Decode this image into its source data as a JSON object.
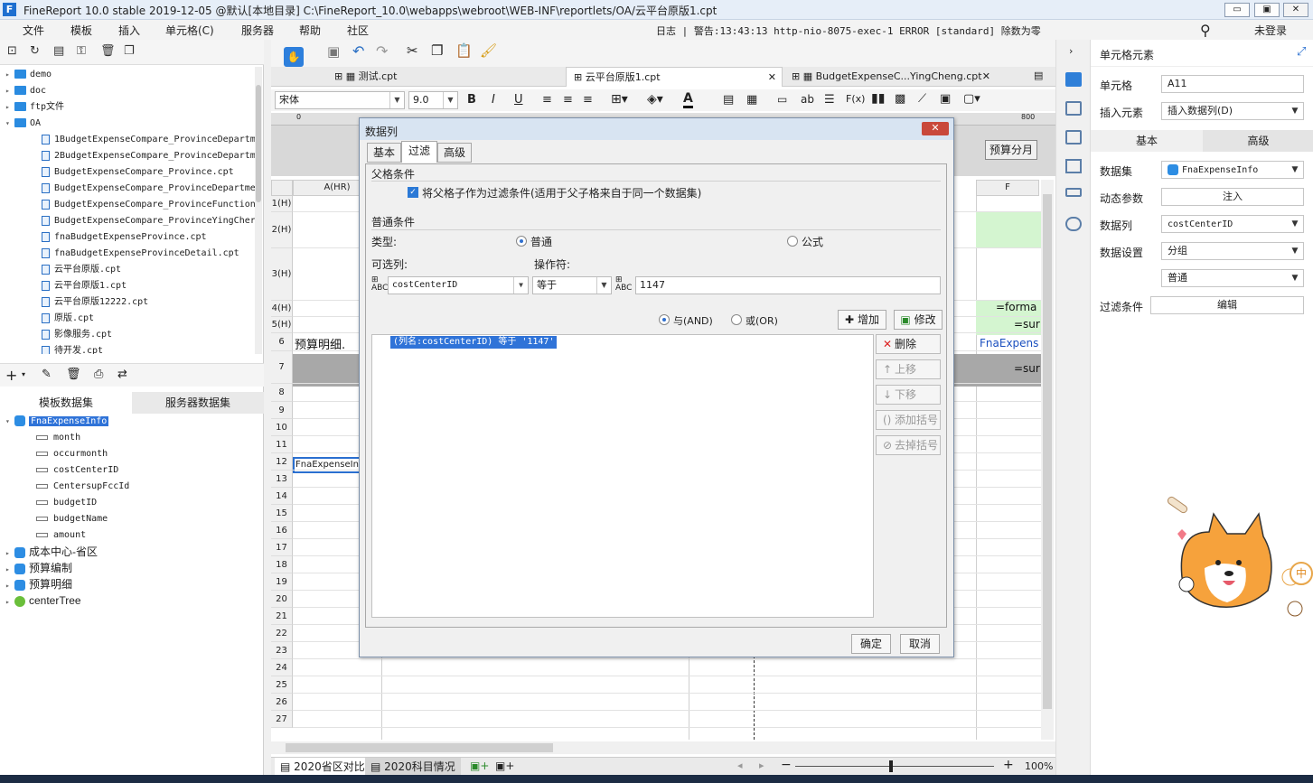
{
  "window": {
    "title": "FineReport 10.0 stable 2019-12-05 @默认[本地目录]    C:\\FineReport_10.0\\webapps\\webroot\\WEB-INF\\reportlets/OA/云平台原版1.cpt",
    "logo": "F",
    "min": "▭",
    "max": "▣",
    "close": "✕"
  },
  "menu": {
    "items": [
      "文件",
      "模板",
      "插入",
      "单元格(C)",
      "服务器",
      "帮助",
      "社区"
    ],
    "status": "日志 | 警告:13:43:13 http-nio-8075-exec-1 ERROR [standard] 除数为零",
    "login": "未登录",
    "search": "⚲"
  },
  "tree": {
    "items": [
      {
        "label": "demo",
        "kind": "folder",
        "open": false
      },
      {
        "label": "doc",
        "kind": "folder",
        "open": false
      },
      {
        "label": "ftp文件",
        "kind": "folder",
        "open": false
      },
      {
        "label": "OA",
        "kind": "folder",
        "open": true
      },
      {
        "label": "1BudgetExpenseCompare_ProvinceDepartm",
        "kind": "file"
      },
      {
        "label": "2BudgetExpenseCompare_ProvinceDepartm",
        "kind": "file"
      },
      {
        "label": "BudgetExpenseCompare_Province.cpt",
        "kind": "file"
      },
      {
        "label": "BudgetExpenseCompare_ProvinceDepartme",
        "kind": "file"
      },
      {
        "label": "BudgetExpenseCompare_ProvinceFunction",
        "kind": "file"
      },
      {
        "label": "BudgetExpenseCompare_ProvinceYingCher",
        "kind": "file"
      },
      {
        "label": "fnaBudgetExpenseProvince.cpt",
        "kind": "file"
      },
      {
        "label": "fnaBudgetExpenseProvinceDetail.cpt",
        "kind": "file"
      },
      {
        "label": "云平台原版.cpt",
        "kind": "file"
      },
      {
        "label": "云平台原版1.cpt",
        "kind": "file"
      },
      {
        "label": "云平台原版12222.cpt",
        "kind": "file"
      },
      {
        "label": "原版.cpt",
        "kind": "file"
      },
      {
        "label": "影像服务.cpt",
        "kind": "file"
      },
      {
        "label": "待开发.cpt",
        "kind": "file"
      }
    ]
  },
  "datasets": {
    "tabs": [
      "模板数据集",
      "服务器数据集"
    ],
    "items": [
      {
        "label": "FnaExpenseInfo",
        "level": 0,
        "selected": true
      },
      {
        "label": "month",
        "level": 1
      },
      {
        "label": "occurmonth",
        "level": 1
      },
      {
        "label": "costCenterID",
        "level": 1
      },
      {
        "label": "CentersupFccId",
        "level": 1
      },
      {
        "label": "budgetID",
        "level": 1
      },
      {
        "label": "budgetName",
        "level": 1
      },
      {
        "label": "amount",
        "level": 1
      },
      {
        "label": "成本中心-省区",
        "level": 0
      },
      {
        "label": "预算编制",
        "level": 0
      },
      {
        "label": "预算明细",
        "level": 0
      },
      {
        "label": "centerTree",
        "level": 0,
        "tree": true
      }
    ]
  },
  "doctabs": [
    {
      "label": "测试.cpt"
    },
    {
      "label": "云平台原版1.cpt",
      "active": true
    },
    {
      "label": "BudgetExpenseC...YingCheng.cpt"
    }
  ],
  "format": {
    "font": "宋体",
    "size": "9.0"
  },
  "grid": {
    "col_a": "A(HR)",
    "col_f": "F",
    "rows": [
      "1(H)",
      "2(H)",
      "3(H)",
      "4(H)",
      "5(H)",
      "6",
      "7",
      "8",
      "9",
      "10",
      "11",
      "12",
      "13",
      "14",
      "15",
      "16",
      "17",
      "18",
      "19",
      "20",
      "21",
      "22",
      "23",
      "24",
      "25",
      "26",
      "27"
    ],
    "cell_a6": "预算明细.",
    "cell_a11": "FnaExpenseIn",
    "cell_f4": "=forma",
    "cell_f5": "=sur",
    "cell_f6": "FnaExpens",
    "cell_f7": "=sur",
    "ruler_800": "800",
    "budget_month": "预算分月",
    "ruler_zero": "0"
  },
  "sheets": [
    "2020省区对比",
    "2020科目情况"
  ],
  "zoom": "100%",
  "dialog": {
    "title": "数据列",
    "close": "✕",
    "tabs": [
      "基本",
      "过滤",
      "高级"
    ],
    "parent_group": "父格条件",
    "parent_check": "将父格子作为过滤条件(适用于父子格来自于同一个数据集)",
    "common_group": "普通条件",
    "type_label": "类型:",
    "type_normal": "普通",
    "type_formula": "公式",
    "col_label": "可选列:",
    "op_label": "操作符:",
    "column": "costCenterID",
    "operator": "等于",
    "value": "1147",
    "and_label": "与(AND)",
    "or_label": "或(OR)",
    "add": "增加",
    "modify": "修改",
    "conditions": [
      "(列名:costCenterID) 等于 '1147'"
    ],
    "side": {
      "delete": "删除",
      "up": "上移",
      "down": "下移",
      "add_paren": "添加括号",
      "remove_paren": "去掉括号"
    },
    "ok": "确定",
    "cancel": "取消"
  },
  "rightpanel": {
    "header": "单元格元素",
    "cell_label": "单元格",
    "cell_value": "A11",
    "insert_label": "插入元素",
    "insert_value": "插入数据列(D)",
    "tabs": [
      "基本",
      "高级"
    ],
    "dataset_label": "数据集",
    "dataset_value": "FnaExpenseInfo",
    "dynparam_label": "动态参数",
    "dynparam_btn": "注入",
    "column_label": "数据列",
    "column_value": "costCenterID",
    "setting_label": "数据设置",
    "setting_value": "分组",
    "setting_value2": "普通",
    "filter_label": "过滤条件",
    "filter_btn": "编辑"
  },
  "mascot": {
    "badge1": "中"
  }
}
